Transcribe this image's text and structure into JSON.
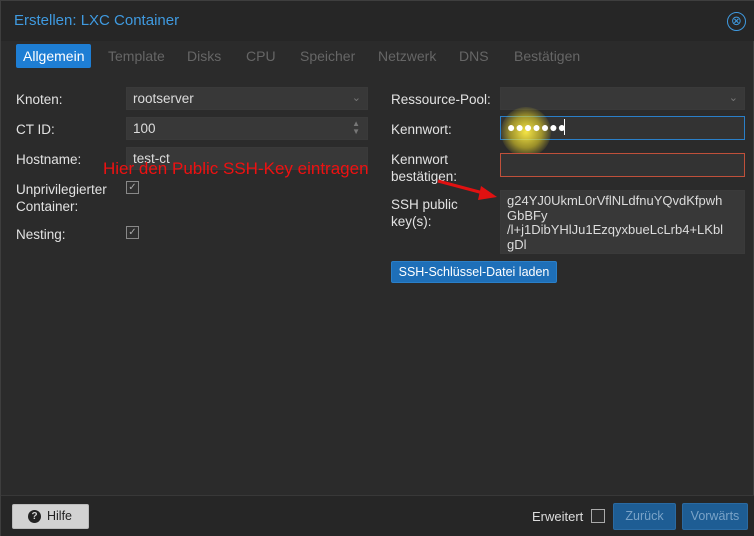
{
  "window": {
    "title": "Erstellen: LXC Container",
    "close_glyph": "⊗"
  },
  "tabs": [
    {
      "label": "Allgemein",
      "active": true
    },
    {
      "label": "Template"
    },
    {
      "label": "Disks"
    },
    {
      "label": "CPU"
    },
    {
      "label": "Speicher"
    },
    {
      "label": "Netzwerk"
    },
    {
      "label": "DNS"
    },
    {
      "label": "Bestätigen"
    }
  ],
  "left_form": {
    "node_label": "Knoten:",
    "node_value": "rootserver",
    "ctid_label": "CT ID:",
    "ctid_value": "100",
    "hostname_label": "Hostname:",
    "hostname_value": "test-ct",
    "unpriv_label": "Unprivilegierter\nContainer:",
    "unpriv_checked": true,
    "nesting_label": "Nesting:",
    "nesting_checked": true
  },
  "right_form": {
    "pool_label": "Ressource-Pool:",
    "pool_value": "",
    "password_label": "Kennwort:",
    "password_mask": "●●●●●●●",
    "confirm_label": "Kennwort\nbestätigen:",
    "confirm_value": "",
    "ssh_label": "SSH public\nkey(s):",
    "ssh_value": "g24YJ0UkmL0rVflNLdfnuYQvdKfpwh\nGbBFy\n/l+j1DibYHlJu1EzqyxbueLcLrb4+LKbl\ngDl",
    "ssh_load_button": "SSH-Schlüssel-Datei laden"
  },
  "annotation": {
    "text": "Hier den Public SSH-Key eintragen",
    "color": "#e11111"
  },
  "footer": {
    "help_label": "Hilfe",
    "advanced_label": "Erweitert",
    "advanced_checked": false,
    "back_label": "Zurück",
    "next_label": "Vorwärts"
  },
  "icons": {
    "close": "close-icon",
    "help": "help-icon",
    "dropdown": "chevron-down-icon",
    "spinner": "spinner-icon",
    "check": "checkmark-icon"
  },
  "colors": {
    "accent": "#1e7ed4",
    "title": "#3f9ae0",
    "invalid_border": "#c0503a"
  }
}
